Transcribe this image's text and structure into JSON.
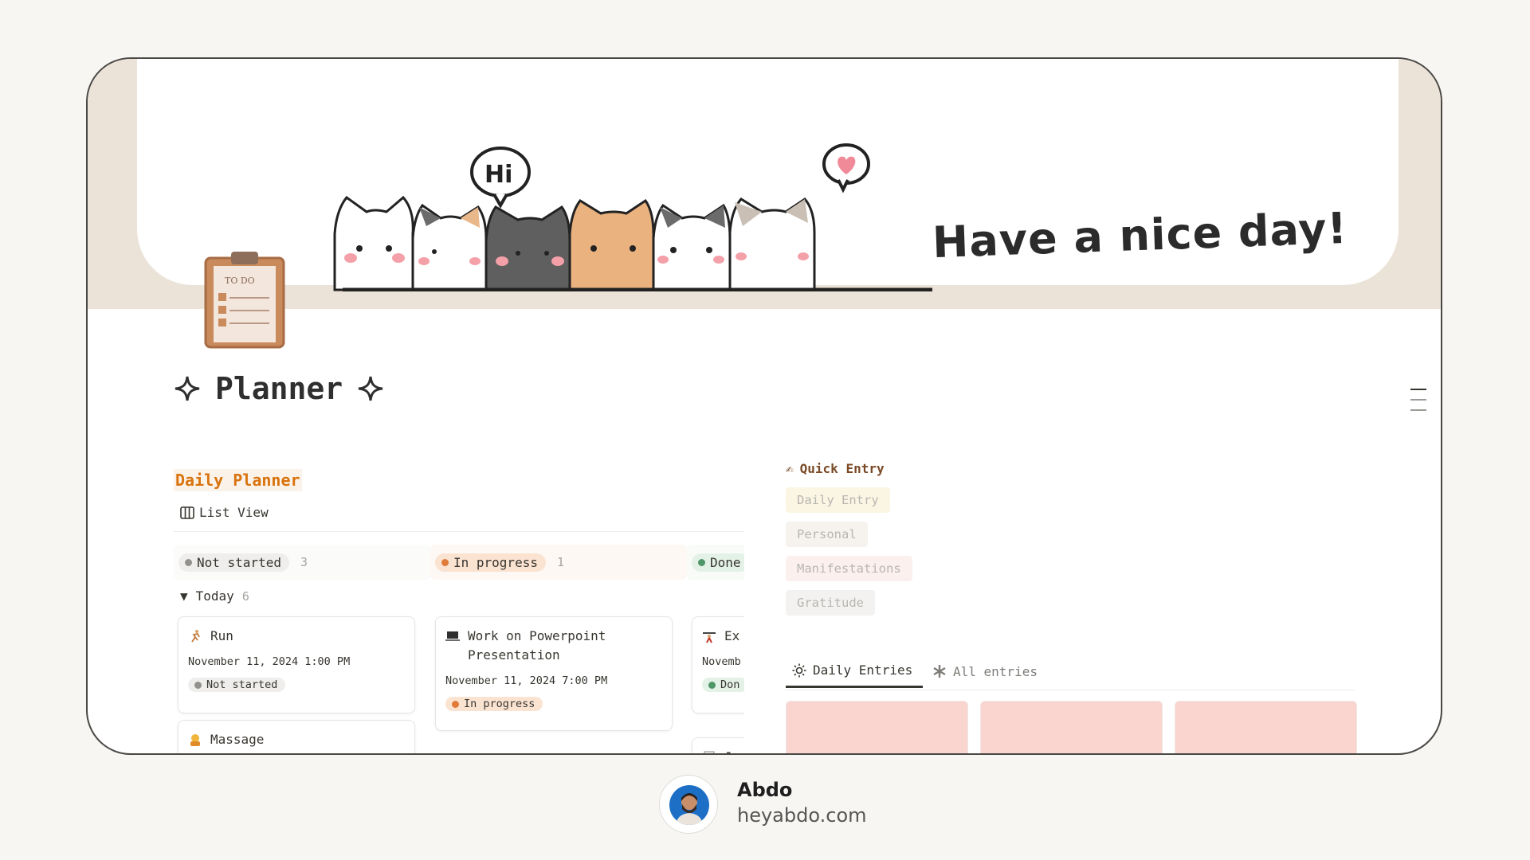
{
  "banner": {
    "greeting": "Have a nice day!",
    "speech_hi": "Hi",
    "clipboard_label": "TO DO"
  },
  "page": {
    "title": "Planner"
  },
  "daily_planner": {
    "heading": "Daily Planner",
    "view_label": "List View",
    "columns": [
      {
        "label": "Not started",
        "count": "3",
        "color": "#91918e",
        "bg": "#efeeec"
      },
      {
        "label": "In progress",
        "count": "1",
        "color": "#e07b39",
        "bg": "#fbe3d2"
      },
      {
        "label": "Done",
        "count": "",
        "color": "#4f9768",
        "bg": "#e3f1e7"
      }
    ],
    "group": {
      "label": "Today",
      "count": "6"
    },
    "cards": [
      {
        "icon": "running-icon",
        "title": "Run",
        "date": "November 11, 2024 1:00 PM",
        "status": "Not started"
      },
      {
        "icon": "laptop-icon",
        "title": "Work on Powerpoint Presentation",
        "date": "November 11, 2024 7:00 PM",
        "status": "In progress"
      },
      {
        "icon": "weightlifting-icon",
        "title": "Ex",
        "date": "Novemb",
        "status": "Don"
      },
      {
        "icon": "massage-icon",
        "title": "Massage"
      },
      {
        "icon": "journal-icon",
        "title": "Jo"
      }
    ]
  },
  "quick_entry": {
    "heading": "Quick Entry",
    "buttons": [
      {
        "label": "Daily Entry",
        "bg": "#fbf6e4"
      },
      {
        "label": "Personal",
        "bg": "#f6f2ee"
      },
      {
        "label": "Manifestations",
        "bg": "#fcf0ef"
      },
      {
        "label": "Gratitude",
        "bg": "#f3f2f0"
      }
    ]
  },
  "entries_tabs": {
    "daily": "Daily Entries",
    "all": "All entries"
  },
  "footer": {
    "name": "Abdo",
    "site": "heyabdo.com"
  }
}
